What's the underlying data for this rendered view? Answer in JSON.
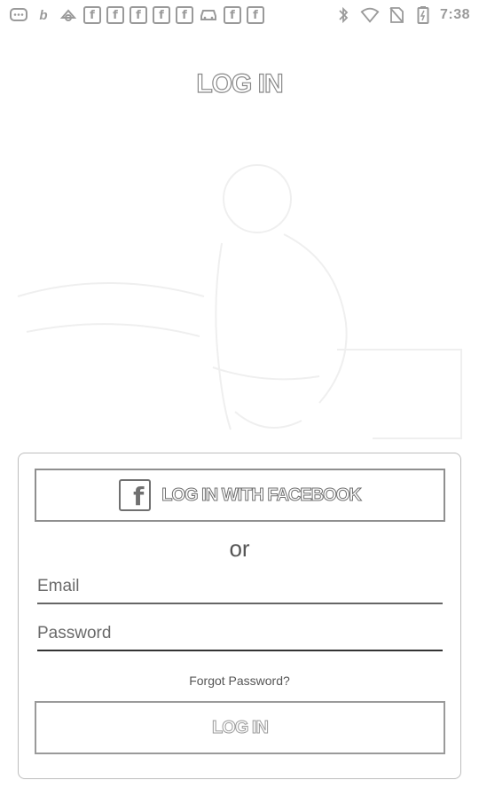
{
  "status_bar": {
    "time": "7:38",
    "left_icons": [
      "messages-icon",
      "b-app-icon",
      "app-icon",
      "facebook-icon",
      "facebook-icon",
      "facebook-icon",
      "facebook-icon",
      "facebook-icon",
      "car-icon",
      "facebook-icon",
      "facebook-icon"
    ],
    "right_icons": [
      "bluetooth-icon",
      "wifi-icon",
      "no-sim-icon",
      "battery-icon"
    ]
  },
  "page": {
    "title": "LOG IN"
  },
  "login_card": {
    "facebook_button_label": "LOG IN WITH FACEBOOK",
    "facebook_logo_glyph": "f",
    "or_text": "or",
    "email_placeholder": "Email",
    "password_placeholder": "Password",
    "forgot_password": "Forgot Password?",
    "login_button_label": "LOG IN"
  },
  "colors": {
    "background": "#ffffff",
    "outline": "#8f8f8f",
    "text": "#555555"
  }
}
